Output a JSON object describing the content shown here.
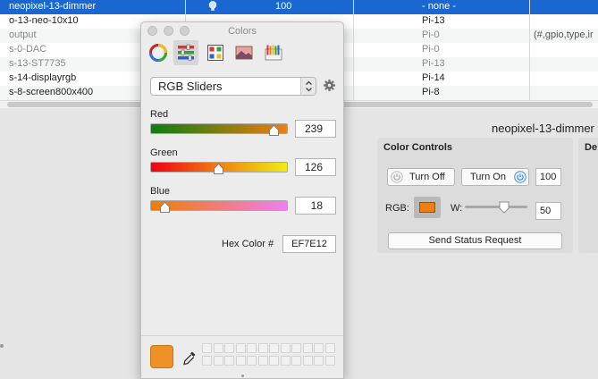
{
  "table": {
    "rows": [
      {
        "name": "neopixel-13-dimmer",
        "value": "100",
        "pin": "- none -",
        "extra": "",
        "selected": true
      },
      {
        "name": "o-13-neo-10x10",
        "value": "",
        "pin": "Pi-13",
        "extra": ""
      },
      {
        "name": "output",
        "value": "",
        "pin": "Pi-0",
        "extra": "(#,gpio,type,ir"
      },
      {
        "name": "s-0-DAC",
        "value": "",
        "pin": "Pi-0",
        "extra": ""
      },
      {
        "name": "s-13-ST7735",
        "value": "",
        "pin": "Pi-13",
        "extra": ""
      },
      {
        "name": "s-14-displayrgb",
        "value": "",
        "pin": "Pi-14",
        "extra": ""
      },
      {
        "name": "s-8-screen800x400",
        "value": "",
        "pin": "Pi-8",
        "extra": ""
      }
    ]
  },
  "device_title": "neopixel-13-dimmer",
  "color_controls": {
    "title": "Color Controls",
    "turn_off_label": "Turn Off",
    "turn_on_label": "Turn On",
    "level_value": "100",
    "rgb_label": "RGB:",
    "rgb_swatch_color": "#EF7E12",
    "w_label": "W:",
    "w_value": "50",
    "w_level": 0.65,
    "status_button_label": "Send Status Request"
  },
  "de_panel": {
    "title": "De"
  },
  "colors_panel": {
    "title": "Colors",
    "toolbar_icons": [
      "color-wheel-icon",
      "color-sliders-icon",
      "color-palettes-icon",
      "image-palettes-icon",
      "crayons-icon"
    ],
    "mode_label": "RGB Sliders",
    "sliders": [
      {
        "label": "Red",
        "value": "239",
        "level": 0.937
      },
      {
        "label": "Green",
        "value": "126",
        "level": 0.494
      },
      {
        "label": "Blue",
        "value": "18",
        "level": 0.071
      }
    ],
    "hex_label": "Hex Color #",
    "hex_value": "EF7E12",
    "current_color": "#EF9128"
  },
  "colors": {
    "selection": "#1a67d2",
    "accent": "#3b8de8"
  }
}
